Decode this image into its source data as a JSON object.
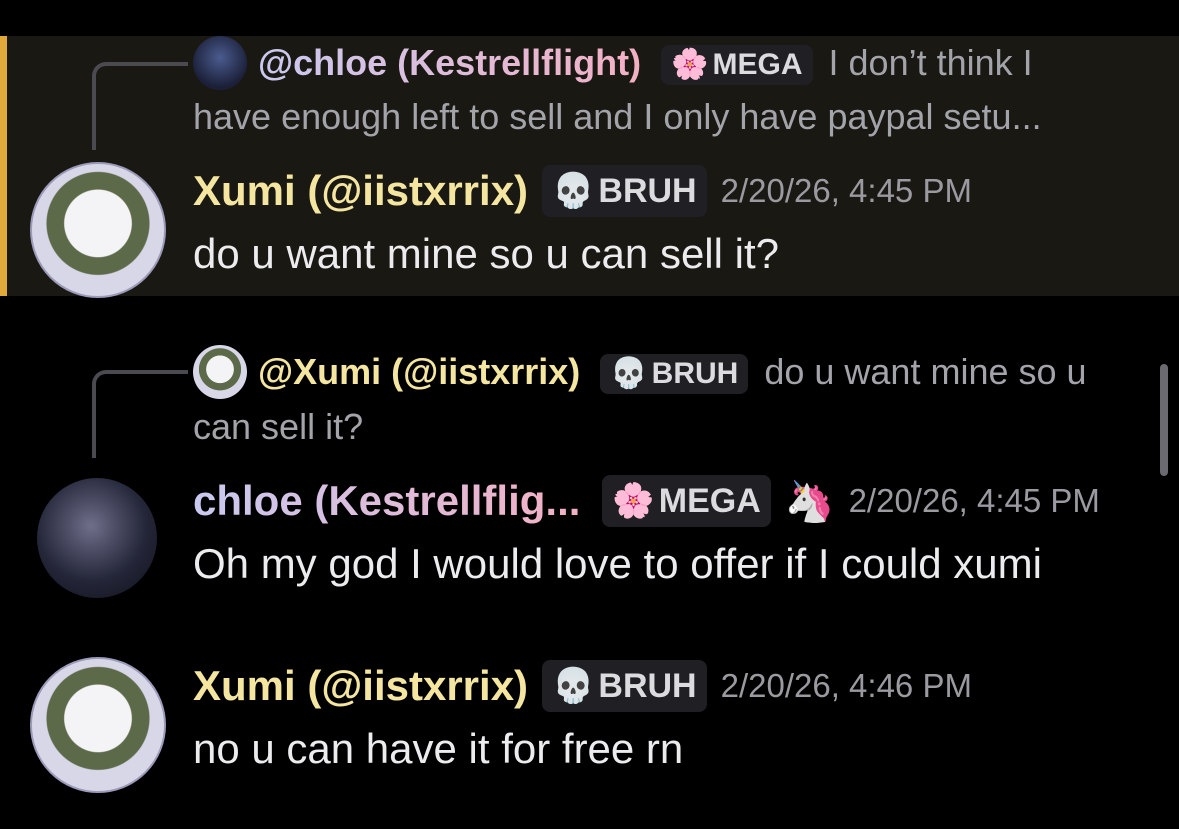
{
  "messages": [
    {
      "reply": {
        "user": "@chloe (Kestrellflight)",
        "tag": "MEGA",
        "text_line1": "I don’t think I",
        "text_line2": "have enough left to sell and I only have paypal setu..."
      },
      "author": "Xumi (@iistxrrix)",
      "tag": "BRUH",
      "timestamp": "2/20/26, 4:45 PM",
      "text": "do u want mine so u can sell it?"
    },
    {
      "reply": {
        "user": "@Xumi (@iistxrrix)",
        "tag": "BRUH",
        "text_line1": "do u want mine so u",
        "text_line2": "can sell it?"
      },
      "author": "chloe (Kestrellflig...",
      "tag": "MEGA",
      "emoji": "🦄",
      "timestamp": "2/20/26, 4:45 PM",
      "text": "Oh my god I would love to offer if I could xumi"
    },
    {
      "author": "Xumi (@iistxrrix)",
      "tag": "BRUH",
      "timestamp": "2/20/26, 4:46 PM",
      "text": "no u can have it for free rn"
    }
  ],
  "icons": {
    "skull": "💀",
    "flower": "🌸"
  },
  "colors": {
    "highlight_bar": "#e1a93a",
    "highlight_bg": "#1a1813",
    "xumi_name": "#f4e6a0",
    "chloe_gradient_start": "#c9c9f0",
    "chloe_gradient_end": "#f3b0c4"
  }
}
